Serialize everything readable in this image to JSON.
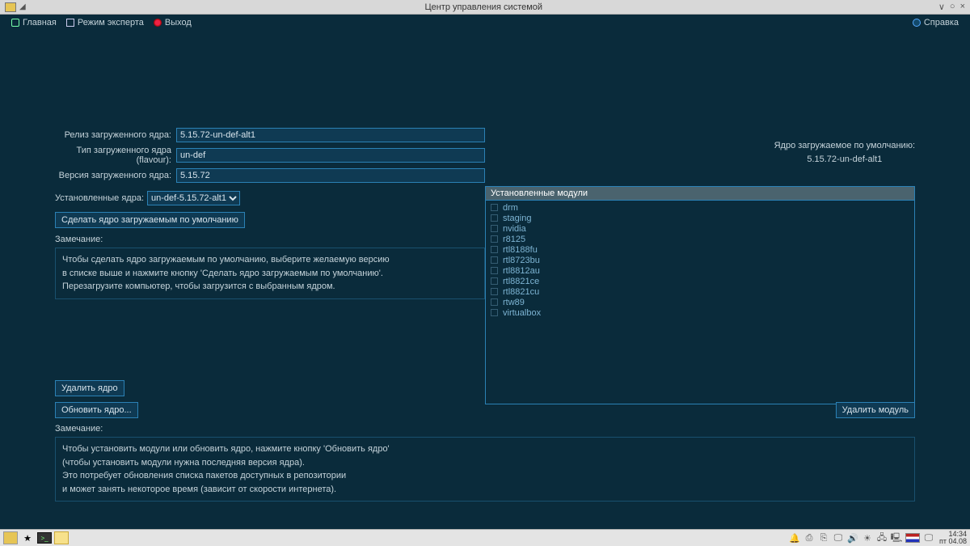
{
  "window": {
    "title": "Центр управления системой"
  },
  "menu": {
    "home": "Главная",
    "expert": "Режим эксперта",
    "exit": "Выход",
    "help": "Справка"
  },
  "fields": {
    "release_label": "Релиз загруженного ядра:",
    "release_value": "5.15.72-un-def-alt1",
    "flavour_label": "Тип загруженного ядра (flavour):",
    "flavour_value": "un-def",
    "version_label": "Версия загруженного ядра:",
    "version_value": "5.15.72"
  },
  "right": {
    "l1": "Ядро загружаемое по умолчанию:",
    "l2": "5.15.72-un-def-alt1"
  },
  "installed": {
    "label": "Установленные ядра:",
    "option": "un-def-5.15.72-alt1"
  },
  "buttons": {
    "set_default": "Сделать ядро загружаемым по умолчанию",
    "delete_kernel": "Удалить ядро",
    "update_kernel": "Обновить ядро...",
    "delete_module": "Удалить модуль"
  },
  "note1": {
    "label": "Замечание:",
    "l1": "Чтобы сделать ядро загружаемым по умолчанию, выберите желаемую версию",
    "l2": "в списке выше и нажмите кнопку 'Сделать ядро загружаемым по умолчанию'.",
    "l3": "Перезагрузите компьютер, чтобы загрузится с выбранным ядром."
  },
  "note2": {
    "label": "Замечание:",
    "l1": "Чтобы установить модули или обновить ядро, нажмите кнопку 'Обновить ядро'",
    "l2": "(чтобы установить модули нужна последняя версия ядра).",
    "l3": "Это потребует обновления списка пакетов доступных в репозитории",
    "l4": "и может занять некоторое время (зависит от скорости интернета)."
  },
  "modules": {
    "header": "Установленные модули",
    "items": [
      "drm",
      "staging",
      "nvidia",
      "r8125",
      "rtl8188fu",
      "rtl8723bu",
      "rtl8812au",
      "rtl8821ce",
      "rtl8821cu",
      "rtw89",
      "virtualbox"
    ]
  },
  "clock": {
    "time": "14:34",
    "date": "пт 04.08"
  }
}
